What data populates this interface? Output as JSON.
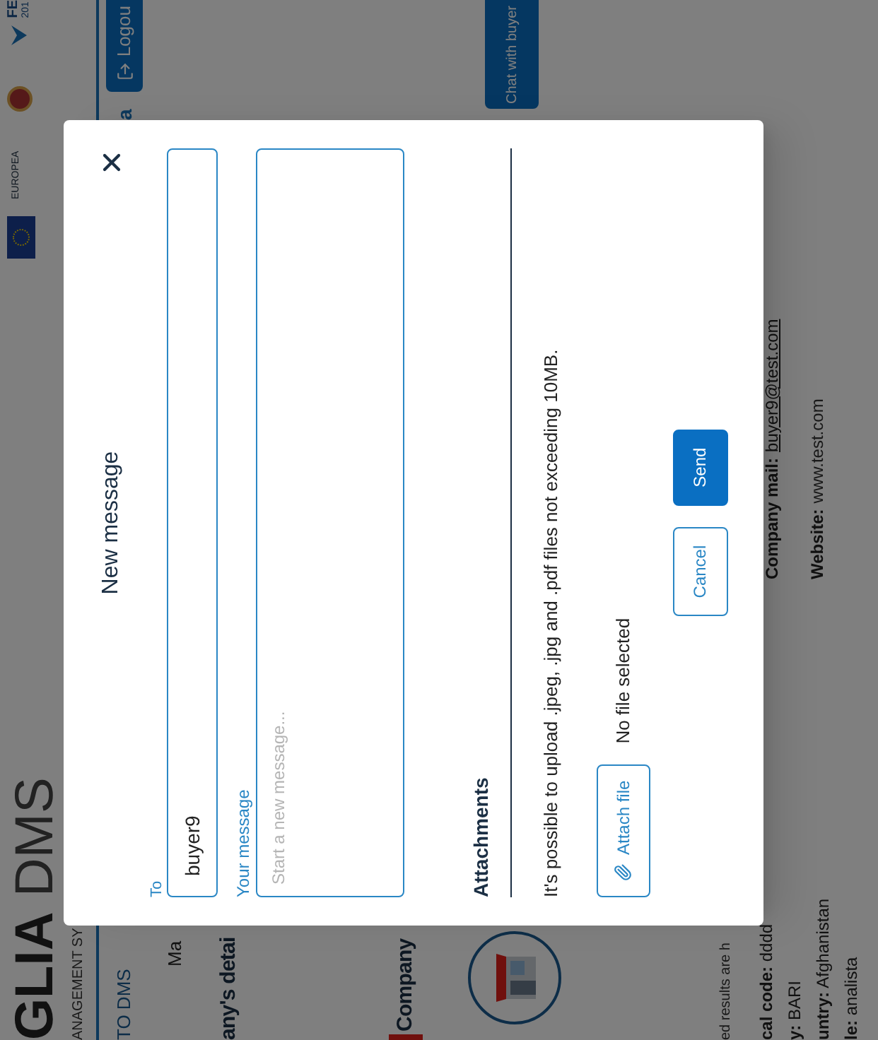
{
  "header": {
    "logo": {
      "bold": "GLIA",
      "light": "DMS"
    },
    "tagline": "ANAGEMENT SY",
    "partner_label": "EUROPEA",
    "partner_name": "FE",
    "partner_year": "201"
  },
  "nav": {
    "home_link": "TO DMS",
    "menu_item_cut": "a",
    "logout": "Logou"
  },
  "submenu": "Ma",
  "page_title": "any's detai",
  "section_title": "Company",
  "chat_button": "Chat with buyer",
  "results_note": "ed results are h",
  "details_left": [
    "**cal code:** dddd",
    "**y:** BARI",
    "**untry:** Afghanistan",
    "**le:** analista"
  ],
  "details_right": [
    {
      "label": "Company mail:",
      "value": "buyer9@test.com",
      "kind": "link"
    },
    {
      "label": "Website:",
      "value": "www.test.com",
      "kind": "text"
    }
  ],
  "dialog": {
    "title": "New message",
    "to": {
      "label": "To",
      "value": "buyer9"
    },
    "message": {
      "label": "Your message",
      "placeholder": "Start a new message..."
    },
    "attachments": {
      "title": "Attachments",
      "note": "It's possible to upload .jpeg, .jpg and .pdf files not exceeding 10MB.",
      "button": "Attach file",
      "status": "No file selected"
    },
    "buttons": [
      {
        "label": "Cancel",
        "kind": "secondary"
      },
      {
        "label": "Send",
        "kind": "primary"
      }
    ]
  }
}
